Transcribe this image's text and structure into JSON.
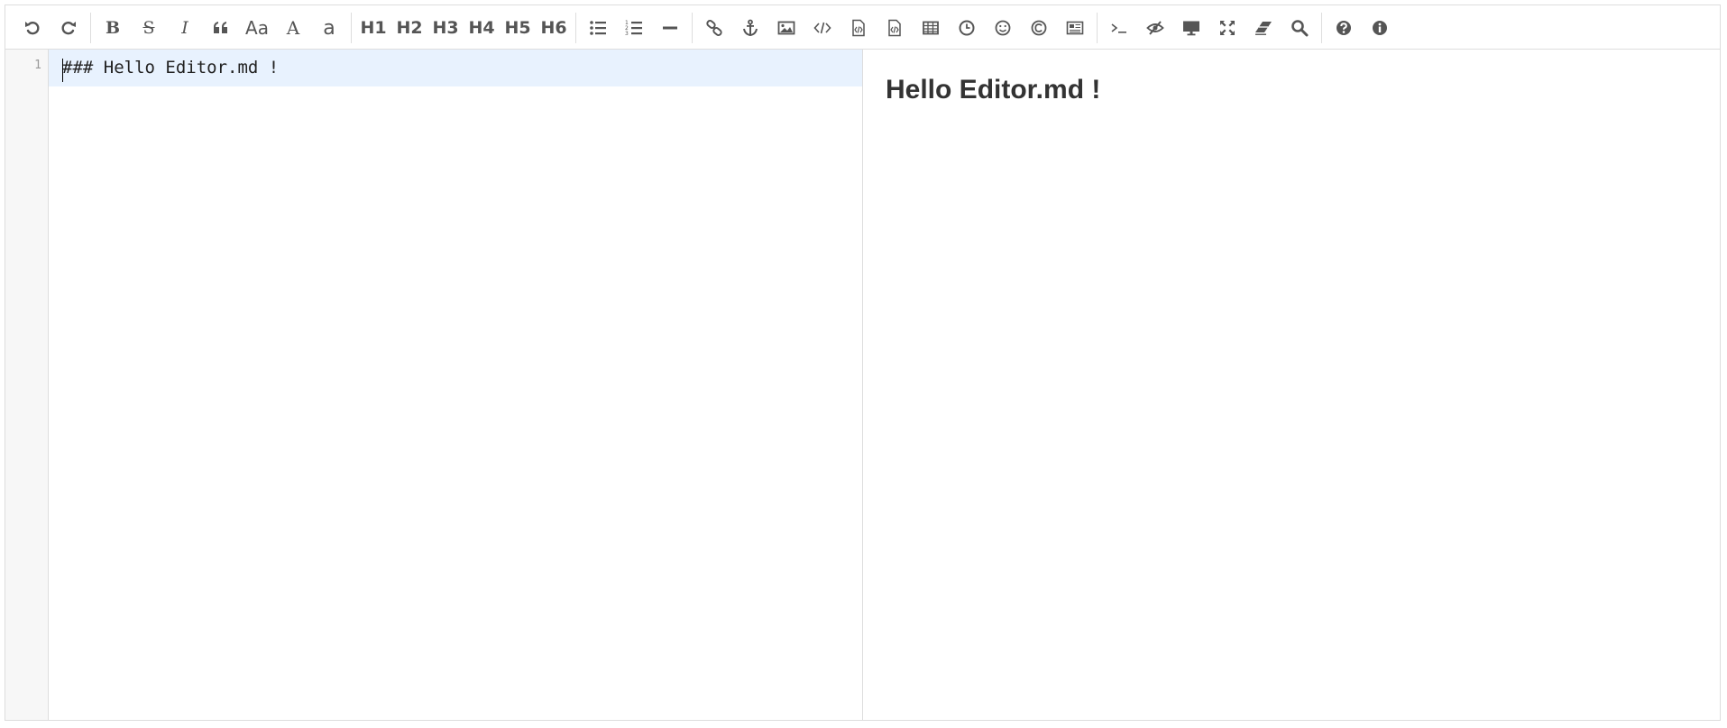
{
  "toolbar": {
    "groups": [
      [
        {
          "name": "undo-icon",
          "label": "Undo"
        },
        {
          "name": "redo-icon",
          "label": "Redo"
        }
      ],
      [
        {
          "name": "bold",
          "text": "B"
        },
        {
          "name": "strikethrough",
          "text": "S"
        },
        {
          "name": "italic",
          "text": "I"
        },
        {
          "name": "quote-icon"
        },
        {
          "name": "uppercase",
          "text": "Aa"
        },
        {
          "name": "ucwords",
          "text": "A"
        },
        {
          "name": "lowercase",
          "text": "a"
        }
      ],
      [
        {
          "name": "h1",
          "text": "H1"
        },
        {
          "name": "h2",
          "text": "H2"
        },
        {
          "name": "h3",
          "text": "H3"
        },
        {
          "name": "h4",
          "text": "H4"
        },
        {
          "name": "h5",
          "text": "H5"
        },
        {
          "name": "h6",
          "text": "H6"
        }
      ],
      [
        {
          "name": "unordered-list-icon"
        },
        {
          "name": "ordered-list-icon"
        },
        {
          "name": "horizontal-rule-icon"
        }
      ],
      [
        {
          "name": "link-icon"
        },
        {
          "name": "anchor-icon"
        },
        {
          "name": "image-icon"
        },
        {
          "name": "inline-code-icon"
        },
        {
          "name": "code-block-icon"
        },
        {
          "name": "preformatted-text-icon"
        },
        {
          "name": "table-icon"
        },
        {
          "name": "datetime-icon"
        },
        {
          "name": "emoji-icon"
        },
        {
          "name": "html-entities-icon"
        },
        {
          "name": "pagebreak-icon"
        }
      ],
      [
        {
          "name": "goto-line-icon"
        },
        {
          "name": "watch-icon"
        },
        {
          "name": "preview-icon"
        },
        {
          "name": "fullscreen-icon"
        },
        {
          "name": "clear-icon"
        },
        {
          "name": "search-icon"
        }
      ],
      [
        {
          "name": "help-icon"
        },
        {
          "name": "info-icon"
        }
      ]
    ]
  },
  "editor": {
    "line_numbers": [
      "1"
    ],
    "lines": [
      "### Hello Editor.md !"
    ]
  },
  "preview": {
    "heading": "Hello Editor.md !"
  },
  "colors": {
    "icon": "#555555",
    "border": "#dddddd",
    "gutter_bg": "#f7f7f7",
    "active_line": "#e8f2fe"
  }
}
